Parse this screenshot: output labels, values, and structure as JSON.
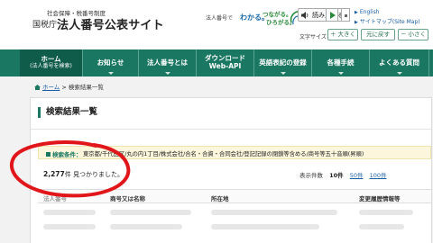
{
  "header": {
    "subtitle": "社会保障・税番号制度",
    "agency": "国税庁",
    "site_title": "法人番号公表サイト",
    "tagline": {
      "part1": "法人番号で",
      "part2": "わかる。",
      "part3": "つながる。",
      "part4": "ひろがる。"
    },
    "read_aloud": "読み上げる",
    "links": {
      "english": "English",
      "sitemap": "サイトマップ(Site Map)"
    },
    "font_size": {
      "label": "文字サイズ",
      "large": "＋ 大きく",
      "reset": "元に戻す",
      "small": "－ 小さく"
    }
  },
  "nav": {
    "items": [
      {
        "label": "ホーム",
        "sub": "(法人番号を検索)"
      },
      {
        "label": "お知らせ",
        "sub": ""
      },
      {
        "label": "法人番号とは",
        "sub": ""
      },
      {
        "label": "ダウンロード",
        "sub": "Web-API"
      },
      {
        "label": "英語表記の登録",
        "sub": ""
      },
      {
        "label": "各種手続",
        "sub": ""
      },
      {
        "label": "よくある質問",
        "sub": ""
      }
    ]
  },
  "breadcrumb": {
    "home": "ホーム",
    "separator": " > ",
    "current": "検索結果一覧"
  },
  "results": {
    "title": "検索結果一覧",
    "condition_label": "検索条件",
    "condition_text": "東京都/千代田区/丸の内1丁目/株式会社/合名・合資・合同会社/登記記録の閉鎖等含める/商号等五十音順(昇順)",
    "count": "2,277",
    "count_suffix": "件 見つかりました。",
    "display_label": "表示件数",
    "display_options": [
      "10件",
      "50件",
      "100件"
    ],
    "display_selected": "10件",
    "columns": [
      "法人番号",
      "商号又は名称",
      "所在地",
      "変更履歴情報等"
    ]
  },
  "colors": {
    "brand_green": "#1a7762",
    "nav_active": "#0f5c4b",
    "annotation_red": "#e0161b",
    "condition_bg": "#fbf6dc"
  }
}
